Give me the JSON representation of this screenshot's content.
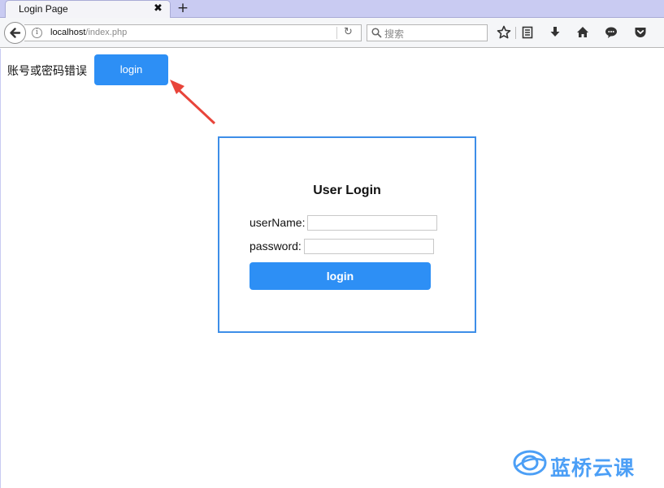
{
  "browser": {
    "tab_title": "Login Page",
    "tab_close": "✖",
    "new_tab": "+",
    "url_host": "localhost",
    "url_path": "/index.php",
    "search_placeholder": "搜索"
  },
  "page": {
    "error_message": "账号或密码错误",
    "top_login_label": "login",
    "box_title": "User Login",
    "username_label": "userName:",
    "username_value": "",
    "password_label": "password:",
    "password_value": "",
    "box_login_label": "login"
  },
  "watermark": {
    "text": "蓝桥云课"
  },
  "colors": {
    "accent": "#2d8ff5",
    "box_border": "#3d8ee8",
    "arrow": "#e8443a",
    "tab_strip": "#c9cbf2"
  }
}
